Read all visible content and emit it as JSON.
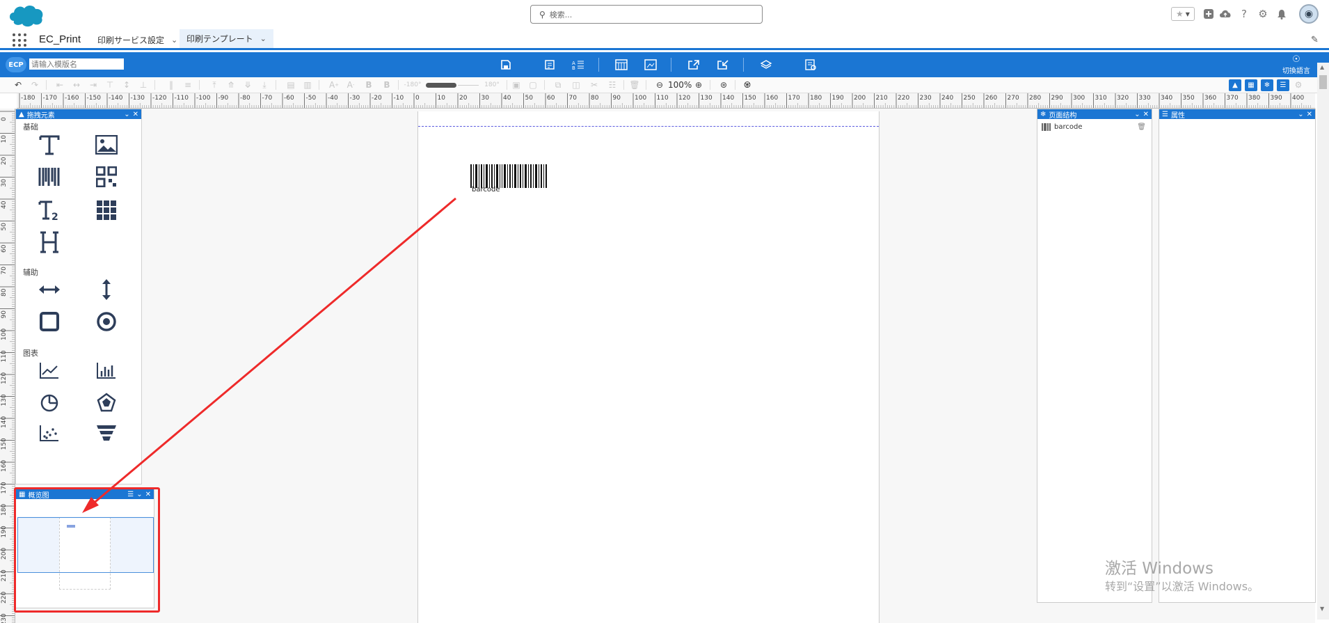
{
  "header": {
    "search_placeholder": "検索...",
    "icons": [
      "star-icon",
      "chevron-down-icon",
      "plus-icon",
      "cloud-upload-icon",
      "help-icon",
      "gear-icon",
      "bell-icon",
      "avatar"
    ]
  },
  "nav": {
    "app_name": "EC_Print",
    "tabs": [
      {
        "label": "印刷サービス設定",
        "active": false
      },
      {
        "label": "印刷テンプレート",
        "active": true
      }
    ]
  },
  "toolbar": {
    "logo": "ECP",
    "template_name_placeholder": "请输入模版名",
    "lang_label": "切換語言",
    "zoom": "100%",
    "rotate_min": "-180°",
    "rotate_max": "180°"
  },
  "element_panel": {
    "title": "拖拽元素",
    "sections": [
      {
        "label": "基础",
        "tools": [
          "text-icon",
          "image-icon",
          "barcode-icon",
          "qrcode-icon",
          "long-text-icon",
          "table-icon",
          "html-icon"
        ]
      },
      {
        "label": "辅助",
        "tools": [
          "horizontal-line-icon",
          "vertical-line-icon",
          "rect-icon",
          "oval-icon"
        ]
      },
      {
        "label": "图表",
        "tools": [
          "line-chart-icon",
          "bar-chart-icon",
          "pie-chart-icon",
          "radar-chart-icon",
          "scatter-chart-icon",
          "funnel-chart-icon"
        ]
      }
    ]
  },
  "thumbnail_panel": {
    "title": "概览图"
  },
  "structure_panel": {
    "title": "页面结构",
    "items": [
      {
        "label": "barcode"
      }
    ]
  },
  "property_panel": {
    "title": "属性"
  },
  "canvas": {
    "barcode_label": "barcode"
  },
  "watermark": {
    "line1": "激活 Windows",
    "line2": "转到“设置”以激活 Windows。"
  },
  "colors": {
    "brand_blue": "#1b76d3",
    "highlight_red": "#ee2a2a",
    "annotation_arrow": "#ee2a2a"
  }
}
